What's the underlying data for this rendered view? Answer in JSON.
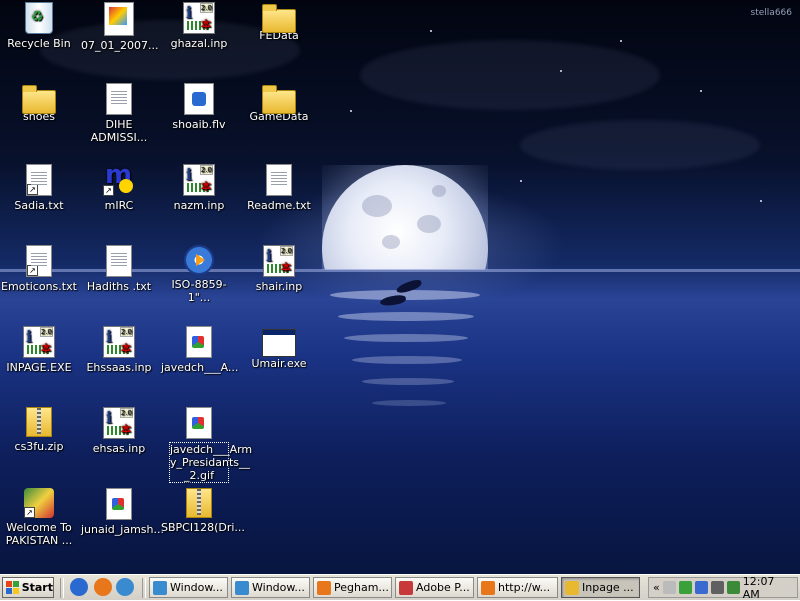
{
  "wallpaper": {
    "watermark": "stella666"
  },
  "icons": [
    {
      "name": "recycle-bin-icon",
      "label": "Recycle Bin",
      "type": "recycle",
      "col": 0,
      "row": 0
    },
    {
      "name": "file-07-01-2007-icon",
      "label": "07_01_2007...",
      "type": "img",
      "col": 1,
      "row": 0
    },
    {
      "name": "ghazal-inp-icon",
      "label": "ghazal.inp",
      "type": "inp",
      "col": 2,
      "row": 0
    },
    {
      "name": "fedata-folder-icon",
      "label": "FEData",
      "type": "folder",
      "col": 3,
      "row": 0
    },
    {
      "name": "shoes-folder-icon",
      "label": "shoes",
      "type": "folder",
      "col": 0,
      "row": 1
    },
    {
      "name": "dihe-admission-icon",
      "label": "DIHE ADMISSI...",
      "type": "doc",
      "col": 1,
      "row": 1
    },
    {
      "name": "shoaib-flv-icon",
      "label": "shoaib.flv",
      "type": "flv",
      "col": 2,
      "row": 1
    },
    {
      "name": "gamedata-folder-icon",
      "label": "GameData",
      "type": "folder",
      "col": 3,
      "row": 1
    },
    {
      "name": "sadia-txt-icon",
      "label": "Sadia.txt",
      "type": "doc",
      "shortcut": true,
      "col": 0,
      "row": 2
    },
    {
      "name": "mirc-icon",
      "label": "mIRC",
      "type": "mirc",
      "shortcut": true,
      "col": 1,
      "row": 2
    },
    {
      "name": "nazm-inp-icon",
      "label": "nazm.inp",
      "type": "inp",
      "col": 2,
      "row": 2
    },
    {
      "name": "readme-txt-icon",
      "label": "Readme.txt",
      "type": "doc",
      "col": 3,
      "row": 2
    },
    {
      "name": "emoticons-txt-icon",
      "label": "Emoticons.txt",
      "type": "doc",
      "shortcut": true,
      "col": 0,
      "row": 3
    },
    {
      "name": "hadiths-txt-icon",
      "label": "Hadiths .txt",
      "type": "doc",
      "col": 1,
      "row": 3
    },
    {
      "name": "iso-8859-icon",
      "label": "ISO-8859-1\"...",
      "type": "wmp",
      "col": 2,
      "row": 3
    },
    {
      "name": "shair-inp-icon",
      "label": "shair.inp",
      "type": "inp",
      "col": 3,
      "row": 3
    },
    {
      "name": "inpage-exe-icon",
      "label": "INPAGE.EXE",
      "type": "inp",
      "col": 0,
      "row": 4
    },
    {
      "name": "ehssaas-inp-icon",
      "label": "Ehssaas.inp",
      "type": "inp",
      "col": 1,
      "row": 4
    },
    {
      "name": "javedch-a-gif-icon",
      "label": "javedch___A...",
      "type": "gif",
      "col": 2,
      "row": 4
    },
    {
      "name": "umair-exe-icon",
      "label": "Umair.exe",
      "type": "exe",
      "col": 3,
      "row": 4
    },
    {
      "name": "cs3fu-zip-icon",
      "label": "cs3fu.zip",
      "type": "zip",
      "col": 0,
      "row": 5
    },
    {
      "name": "ehsas-inp-icon",
      "label": "ehsas.inp",
      "type": "inp",
      "col": 1,
      "row": 5
    },
    {
      "name": "javedch-army-gif-icon",
      "label": "javedch___Arm y_Presidants__ _2.gif",
      "type": "gif",
      "selected": true,
      "col": 2,
      "row": 5
    },
    {
      "name": "welcome-pakistan-icon",
      "label": "Welcome To PAKISTAN ...",
      "type": "welcome",
      "shortcut": true,
      "col": 0,
      "row": 6
    },
    {
      "name": "junaid-jamsh-icon",
      "label": "junaid_jamsh...",
      "type": "gif",
      "col": 1,
      "row": 6
    },
    {
      "name": "sbpci128-zip-icon",
      "label": "SBPCI128(Dri...",
      "type": "zip",
      "col": 2,
      "row": 6
    }
  ],
  "taskbar": {
    "start_label": "Start",
    "quick_launch": [
      {
        "name": "ie-quicklaunch-icon",
        "color": "#2a6ad0"
      },
      {
        "name": "firefox-quicklaunch-icon",
        "color": "#e8761a"
      },
      {
        "name": "messenger-quicklaunch-icon",
        "color": "#3a8ad0"
      }
    ],
    "tasks": [
      {
        "name": "task-window-1",
        "label": "Window...",
        "color": "#3a8ad0"
      },
      {
        "name": "task-window-2",
        "label": "Window...",
        "color": "#3a8ad0"
      },
      {
        "name": "task-pegham",
        "label": "Pegham...",
        "color": "#e8761a"
      },
      {
        "name": "task-adobe",
        "label": "Adobe P...",
        "color": "#c83a3a"
      },
      {
        "name": "task-http",
        "label": "http://w...",
        "color": "#e8761a"
      },
      {
        "name": "task-inpage",
        "label": "Inpage ...",
        "color": "#e8b830",
        "active": true
      }
    ],
    "tray": {
      "chevron": "«",
      "icons": [
        {
          "name": "messenger-tray-icon",
          "color": "#bbbbbb"
        },
        {
          "name": "buddy-tray-icon",
          "color": "#3aa03a"
        },
        {
          "name": "network-tray-icon",
          "color": "#3a6ad0"
        },
        {
          "name": "volume-tray-icon",
          "color": "#606060"
        },
        {
          "name": "update-tray-icon",
          "color": "#3a8a3a"
        }
      ],
      "clock": "12:07 AM"
    }
  },
  "colors": {
    "selection_border": "#ffffff",
    "taskbar_bg": "#d4d0c8"
  }
}
